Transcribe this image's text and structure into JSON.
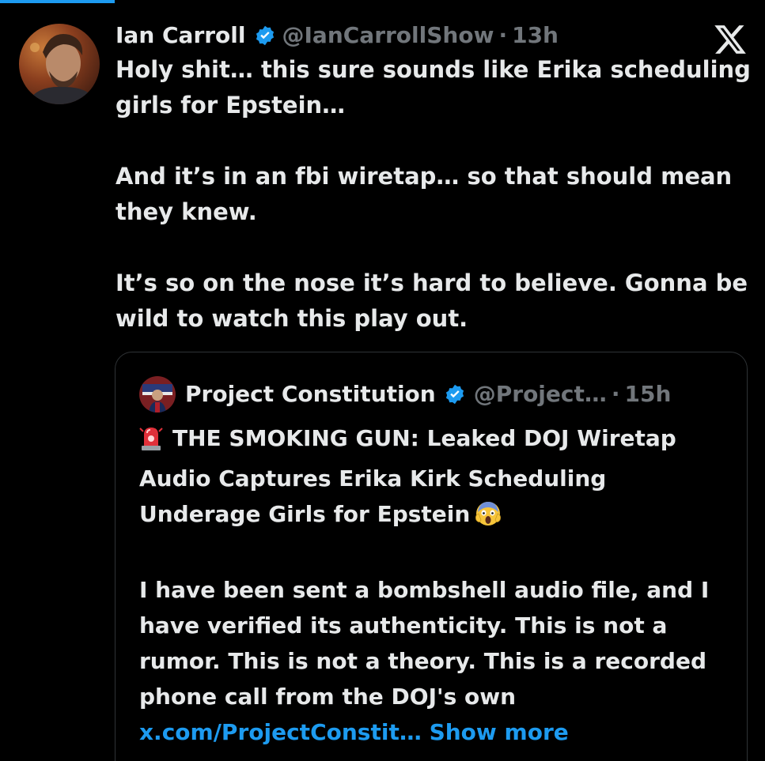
{
  "tweet": {
    "display_name": "Ian Carroll",
    "handle": "@IanCarrollShow",
    "separator": "·",
    "time": "13h",
    "paragraphs": [
      "Holy shit… this sure sounds like Erika scheduling girls for Epstein…",
      "And it’s in an fbi wiretap… so that should mean they knew.",
      "It’s so on the nose it’s hard to believe. Gonna be wild to watch this play out."
    ]
  },
  "quote": {
    "display_name": "Project Constitution",
    "handle": "@Project…",
    "separator": "·",
    "time": "15h",
    "headline": "THE SMOKING GUN: Leaked DOJ Wiretap Audio Captures Erika Kirk Scheduling Underage Girls for Epstein",
    "body": "I have been sent a bombshell audio file, and I have verified its authenticity. This is not a rumor. This is not a theory. This is a recorded phone call from the DOJ's own",
    "link_text": "x.com/ProjectConstit…",
    "show_more": "Show more",
    "headline_leading_icon": "siren-emoji",
    "headline_trailing_icon": "screaming-face-emoji"
  },
  "colors": {
    "background": "#000000",
    "text": "#e7e9ea",
    "muted": "#71767b",
    "accent": "#1d9bf0",
    "card_border": "#2f3336"
  },
  "icons": {
    "verified": "verified-badge-icon",
    "logo": "x-logo-icon"
  }
}
